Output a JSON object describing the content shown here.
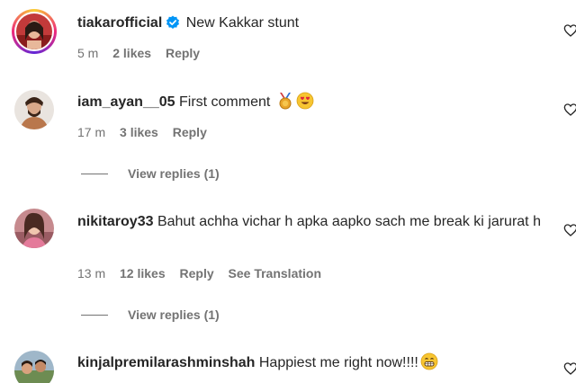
{
  "comments": [
    {
      "username": "tiakarofficial",
      "verified": true,
      "text": "New Kakkar stunt",
      "time": "5 m",
      "likes": "2 likes",
      "reply": "Reply"
    },
    {
      "username": "iam_ayan__05",
      "text": "First comment",
      "emojis": [
        "medal-emoji",
        "heart-eyes-emoji"
      ],
      "time": "17 m",
      "likes": "3 likes",
      "reply": "Reply",
      "view_replies": "View replies (1)"
    },
    {
      "username": "nikitaroy33",
      "text": "Bahut achha vichar h apka aapko sach me break ki jarurat h",
      "time": "13 m",
      "likes": "12 likes",
      "reply": "Reply",
      "see_translation": "See Translation",
      "view_replies": "View replies (1)"
    },
    {
      "username": "kinjalpremilarashminshah",
      "text": "Happiest me right now!!!!",
      "emojis": [
        "grin-emoji"
      ]
    }
  ],
  "icons": {
    "like": "heart-outline-icon",
    "verified": "verified-badge-icon"
  },
  "colors": {
    "text": "#262626",
    "secondary": "#737373",
    "verified": "#0095f6"
  }
}
